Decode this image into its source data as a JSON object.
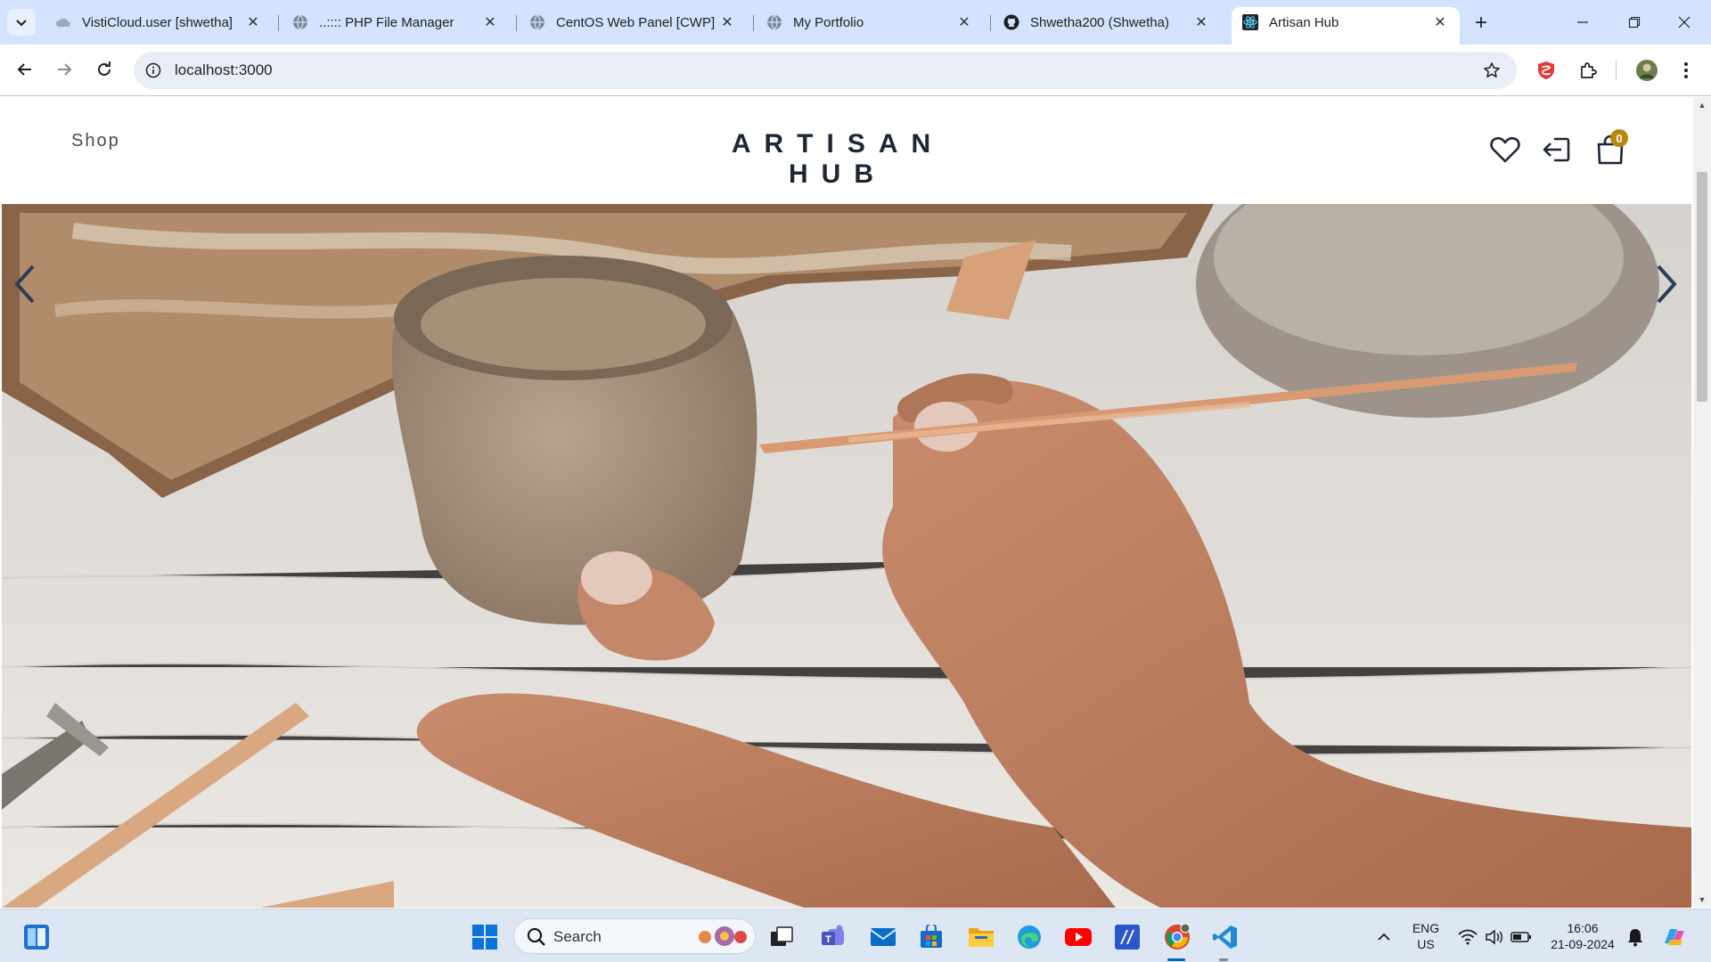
{
  "browser": {
    "tabs": [
      {
        "title": "VistiCloud.user [shwetha]",
        "icon": "cloud-icon"
      },
      {
        "title": "..:::: PHP File Manager",
        "icon": "globe-icon"
      },
      {
        "title": "CentOS Web Panel [CWP]",
        "icon": "globe-icon"
      },
      {
        "title": "My Portfolio",
        "icon": "globe-icon"
      },
      {
        "title": "Shwetha200 (Shwetha)",
        "icon": "github-icon"
      },
      {
        "title": "Artisan Hub",
        "icon": "react-icon",
        "active": true
      }
    ],
    "new_tab_symbol": "+",
    "close_symbol": "✕",
    "url": "localhost:3000"
  },
  "site": {
    "nav_shop": "Shop",
    "brand": "ARTISAN HUB",
    "cart_count": "0",
    "accent_color": "#b8860b",
    "brand_color": "#1c2733"
  },
  "hero": {
    "prev_icon": "chevron-left-icon",
    "next_icon": "chevron-right-icon"
  },
  "taskbar": {
    "search_label": "Search",
    "language_line1": "ENG",
    "language_line2": "US",
    "time": "16:06",
    "date": "21-09-2024"
  }
}
